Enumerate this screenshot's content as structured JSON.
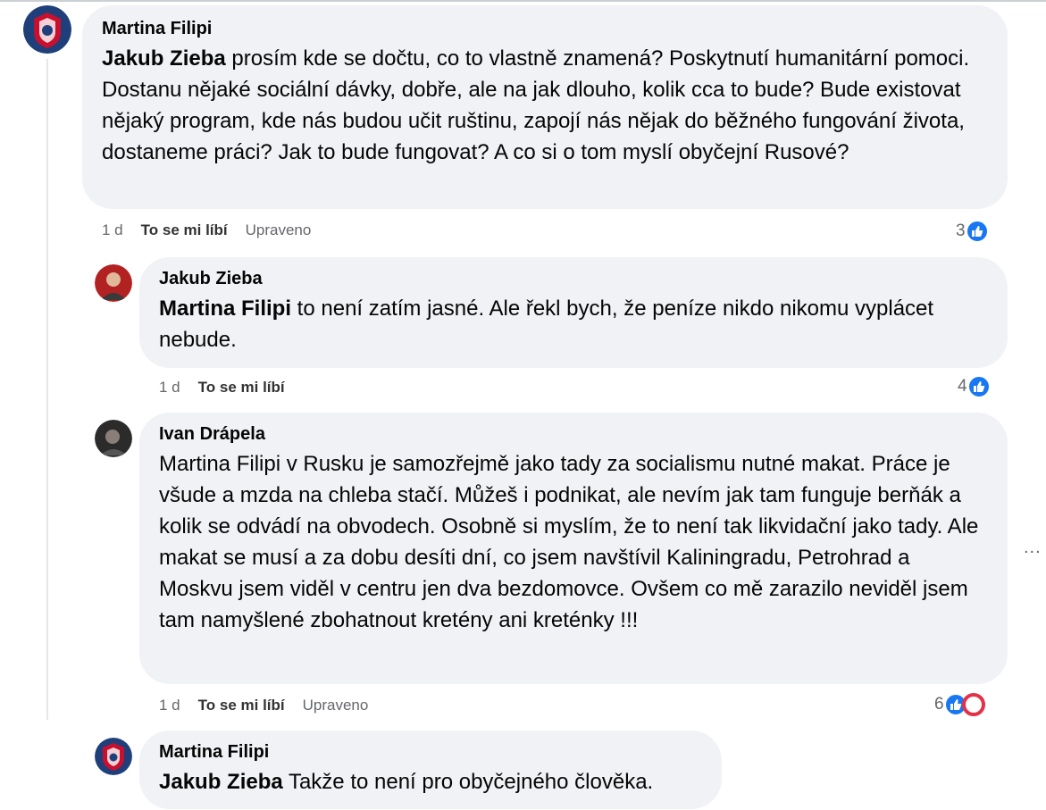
{
  "comments": [
    {
      "author": "Martina Filipi",
      "mention": "Jakub Zieba",
      "text": " prosím kde se dočtu, co to vlastně znamená? Poskytnutí humanitární pomoci. Dostanu nějaké sociální dávky, dobře, ale na jak dlouho, kolik cca to bude? Bude existovat nějaký program, kde nás budou učit ruštinu, zapojí nás nějak do běžného fungování života, dostaneme práci? Jak to bude fungovat? A co si o tom myslí obyčejní Rusové?",
      "time": "1 d",
      "like_label": "To se mi líbí",
      "edited": "Upraveno",
      "reaction_count": "3"
    },
    {
      "author": "Jakub Zieba",
      "mention": "Martina Filipi",
      "text": " to není zatím jasné. Ale řekl bych, že peníze nikdo nikomu vyplácet nebude.",
      "time": "1 d",
      "like_label": "To se mi líbí",
      "reaction_count": "4"
    },
    {
      "author": "Ivan Drápela",
      "text": "Martina Filipi v Rusku je samozřejmě jako tady za socialismu nutné makat. Práce je všude a mzda na chleba stačí. Můžeš i podnikat, ale nevím jak tam funguje berňák a kolik se odvádí na obvodech. Osobně si myslím, že to není tak likvidační jako tady. Ale makat se musí a za dobu desíti dní, co jsem navštívil Kaliningradu, Petrohrad a Moskvu jsem viděl v centru jen dva bezdomovce. Ovšem co mě zarazilo neviděl jsem tam namyšlené zbohatnout kretény ani kreténky !!!",
      "time": "1 d",
      "like_label": "To se mi líbí",
      "edited": "Upraveno",
      "reaction_count": "6"
    },
    {
      "author": "Martina Filipi",
      "mention": "Jakub Zieba",
      "text": " Takže to není pro obyčejného člověka."
    }
  ],
  "more_label": "...",
  "colors": {
    "like": "#1877f2",
    "haha": "#e4314a",
    "bubble": "#f0f2f5"
  },
  "icons": [
    "flag-avatar-icon",
    "like-icon",
    "haha-icon",
    "more-options-icon"
  ]
}
